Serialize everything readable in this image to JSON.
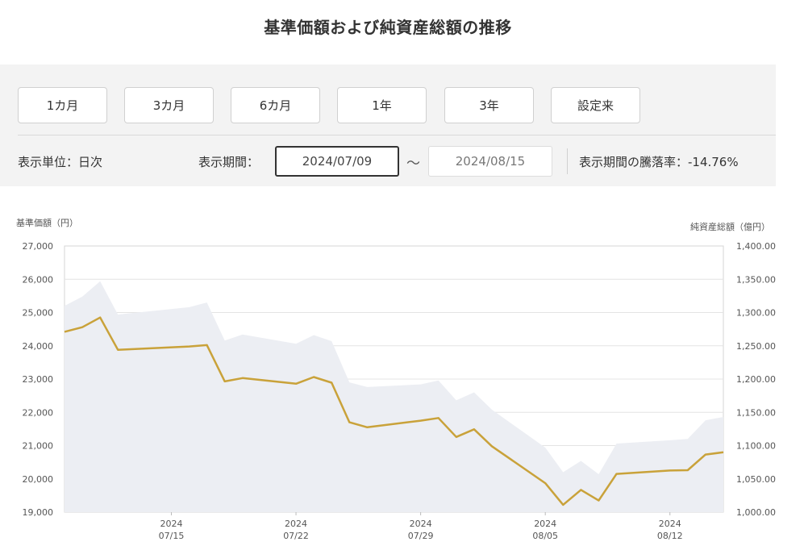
{
  "page": {
    "title": "基準価額および純資産総額の推移"
  },
  "controls": {
    "period_buttons": [
      "1カ月",
      "3カ月",
      "6カ月",
      "1年",
      "3年",
      "設定来"
    ],
    "unit_label": "表示単位：日次",
    "range_label": "表示期間：",
    "date_from": "2024/07/09",
    "tilde": "～",
    "date_to": "2024/08/15",
    "change_rate_label": "表示期間の騰落率：-14.76%"
  },
  "colors": {
    "price_line": "#c9a23a",
    "asset_area": "#eceef3",
    "grid": "#e4e4e4",
    "axis_text": "#555555"
  },
  "chart_data": {
    "type": "line",
    "left_axis_label": "基準価額（円）",
    "right_axis_label": "純資産総額（億円）",
    "left_ylim": [
      19000,
      27000
    ],
    "right_ylim": [
      1000,
      1400
    ],
    "left_ticks": [
      "27,000",
      "26,000",
      "25,000",
      "24,000",
      "23,000",
      "22,000",
      "21,000",
      "20,000",
      "19,000"
    ],
    "right_ticks": [
      "1,400.00",
      "1,350.00",
      "1,300.00",
      "1,250.00",
      "1,200.00",
      "1,150.00",
      "1,100.00",
      "1,050.00",
      "1,000.00"
    ],
    "x_range": [
      "2024/07/09",
      "2024/08/15"
    ],
    "x_ticks": [
      {
        "date": "2024/07/15",
        "year": "2024",
        "label": "07/15"
      },
      {
        "date": "2024/07/22",
        "year": "2024",
        "label": "07/22"
      },
      {
        "date": "2024/07/29",
        "year": "2024",
        "label": "07/29"
      },
      {
        "date": "2024/08/05",
        "year": "2024",
        "label": "08/05"
      },
      {
        "date": "2024/08/12",
        "year": "2024",
        "label": "08/12"
      }
    ],
    "grid": true,
    "series": [
      {
        "name": "基準価額",
        "axis": "left",
        "type": "line",
        "points": [
          [
            "2024/07/09",
            24420
          ],
          [
            "2024/07/10",
            24560
          ],
          [
            "2024/07/11",
            24850
          ],
          [
            "2024/07/12",
            23880
          ],
          [
            "2024/07/16",
            23980
          ],
          [
            "2024/07/17",
            24020
          ],
          [
            "2024/07/18",
            22930
          ],
          [
            "2024/07/19",
            23030
          ],
          [
            "2024/07/22",
            22860
          ],
          [
            "2024/07/23",
            23060
          ],
          [
            "2024/07/24",
            22890
          ],
          [
            "2024/07/25",
            21700
          ],
          [
            "2024/07/26",
            21550
          ],
          [
            "2024/07/29",
            21750
          ],
          [
            "2024/07/30",
            21830
          ],
          [
            "2024/07/31",
            21260
          ],
          [
            "2024/08/01",
            21490
          ],
          [
            "2024/08/02",
            20980
          ],
          [
            "2024/08/05",
            19870
          ],
          [
            "2024/08/06",
            19220
          ],
          [
            "2024/08/07",
            19670
          ],
          [
            "2024/08/08",
            19350
          ],
          [
            "2024/08/09",
            20150
          ],
          [
            "2024/08/12",
            20250
          ],
          [
            "2024/08/13",
            20260
          ],
          [
            "2024/08/14",
            20730
          ],
          [
            "2024/08/15",
            20800
          ]
        ]
      },
      {
        "name": "純資産総額",
        "axis": "right",
        "type": "area",
        "points": [
          [
            "2024/07/09",
            1310
          ],
          [
            "2024/07/10",
            1324
          ],
          [
            "2024/07/11",
            1347
          ],
          [
            "2024/07/12",
            1297
          ],
          [
            "2024/07/16",
            1308
          ],
          [
            "2024/07/17",
            1315
          ],
          [
            "2024/07/18",
            1258
          ],
          [
            "2024/07/19",
            1267
          ],
          [
            "2024/07/22",
            1253
          ],
          [
            "2024/07/23",
            1266
          ],
          [
            "2024/07/24",
            1257
          ],
          [
            "2024/07/25",
            1195
          ],
          [
            "2024/07/26",
            1188
          ],
          [
            "2024/07/29",
            1192
          ],
          [
            "2024/07/30",
            1198
          ],
          [
            "2024/07/31",
            1168
          ],
          [
            "2024/08/01",
            1180
          ],
          [
            "2024/08/02",
            1154
          ],
          [
            "2024/08/05",
            1097
          ],
          [
            "2024/08/06",
            1060
          ],
          [
            "2024/08/07",
            1077
          ],
          [
            "2024/08/08",
            1057
          ],
          [
            "2024/08/09",
            1103
          ],
          [
            "2024/08/12",
            1108
          ],
          [
            "2024/08/13",
            1110
          ],
          [
            "2024/08/14",
            1138
          ],
          [
            "2024/08/15",
            1143
          ]
        ]
      }
    ]
  }
}
